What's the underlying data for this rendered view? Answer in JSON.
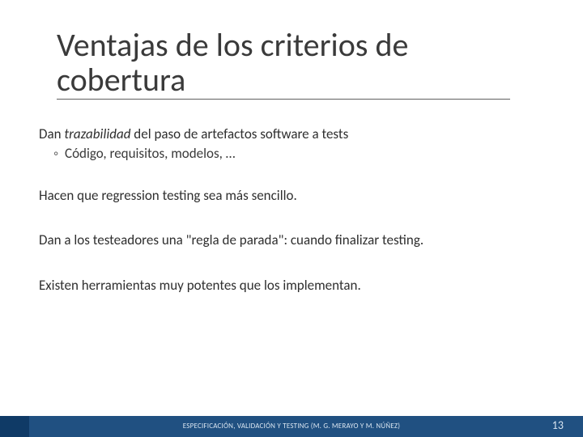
{
  "title": "Ventajas de los criterios de cobertura",
  "body": {
    "p1a": "Dan ",
    "p1b_italic": "trazabilidad",
    "p1c": " del paso de artefactos software a tests",
    "p1_sub": "Código, requisitos, modelos, …",
    "p2": "Hacen que regression testing sea más sencillo.",
    "p3": "Dan a los testeadores una \"regla de parada\": cuando finalizar testing.",
    "p4": "Existen herramientas muy potentes que los implementan."
  },
  "footer": "ESPECIFICACIÓN, VALIDACIÓN Y TESTING (M. G. MERAYO Y M. NÚÑEZ)",
  "page": "13"
}
